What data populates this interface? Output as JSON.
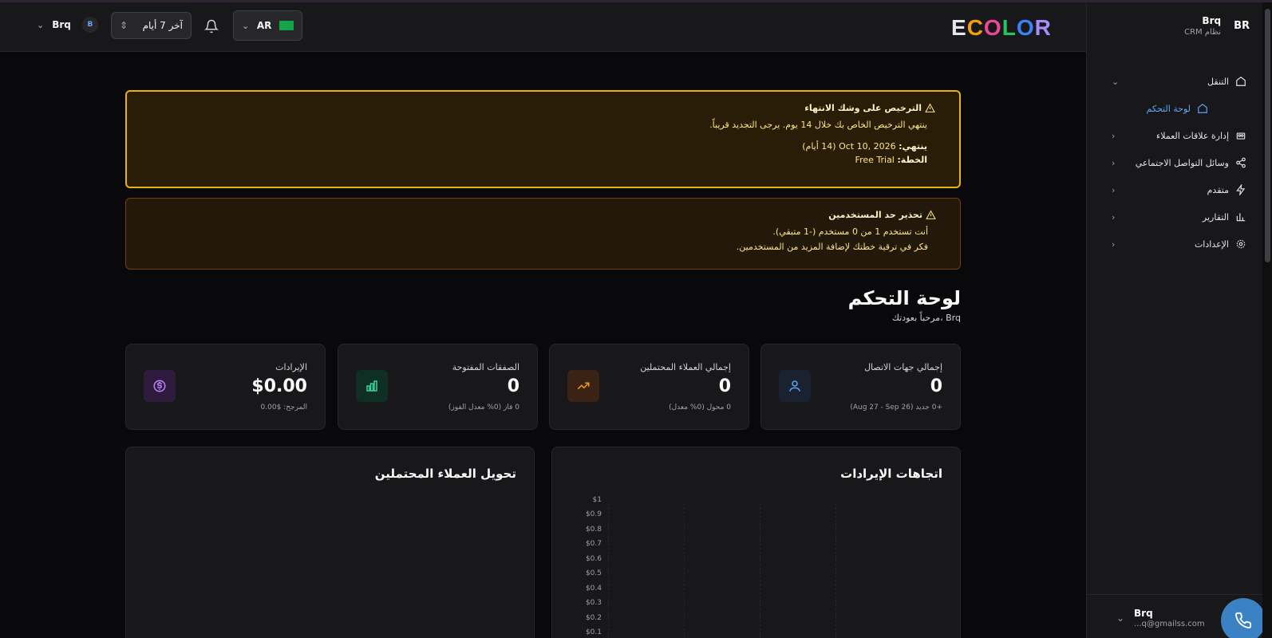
{
  "header": {
    "logo": "ECOLOR",
    "user_name": "Brq",
    "user_badge": "B",
    "period_label": "آخر 7 أيام",
    "language": "AR"
  },
  "sidebar": {
    "avatar": "BR",
    "brand_name": "Brq",
    "brand_sub": "نظام CRM",
    "items": [
      {
        "label": "التنقل",
        "icon": "home-icon"
      },
      {
        "label": "لوحة التحكم",
        "icon": "home-icon"
      },
      {
        "label": "إدارة علاقات العملاء",
        "icon": "users-icon"
      },
      {
        "label": "وسائل التواصل الاجتماعي",
        "icon": "share-icon"
      },
      {
        "label": "متقدم",
        "icon": "bolt-icon"
      },
      {
        "label": "التقارير",
        "icon": "chart-icon"
      },
      {
        "label": "الإعدادات",
        "icon": "gear-icon"
      }
    ],
    "footer_user": "Brq",
    "footer_email": "...q@gmailss.com"
  },
  "alerts": {
    "license": {
      "title": "الترخيص على وشك الانتهاء",
      "message": "ينتهي الترخيص الخاص بك خلال 14 يوم. يرجى التجديد قريباً.",
      "expires_label": "ينتهي:",
      "expires_value": "Oct 10, 2026 (14 أيام)",
      "plan_label": "الخطة:",
      "plan_value": "Free Trial"
    },
    "users": {
      "title": "تحذير حد المستخدمين",
      "line1": "أنت تستخدم 1 من 0 مستخدم (-1 متبقي).",
      "line2": "فكر في ترقية خطتك لإضافة المزيد من المستخدمين."
    }
  },
  "page": {
    "title": "لوحة التحكم",
    "subtitle": "مرحباً بعودتك، Brq"
  },
  "stats": [
    {
      "label": "إجمالي جهات الاتصال",
      "value": "0",
      "note": "+0 جديد (Aug 27 - Sep 26)",
      "icon": "user-icon",
      "color": "#1e293b",
      "accent": "#60a5fa"
    },
    {
      "label": "إجمالي العملاء المحتملين",
      "value": "0",
      "note": "0 محول (0% معدل)",
      "icon": "trending-up-icon",
      "color": "#3a2214",
      "accent": "#f59e0b"
    },
    {
      "label": "الصفقات المفتوحة",
      "value": "0",
      "note": "0 فاز (0% معدل الفوز)",
      "icon": "bar-chart-icon",
      "color": "#0f2e24",
      "accent": "#34d399"
    },
    {
      "label": "الإيرادات",
      "value": "$0.00",
      "note": "المرجح: $0.00",
      "icon": "dollar-icon",
      "color": "#2e1a3d",
      "accent": "#c084fc"
    }
  ],
  "panels": {
    "revenue_title": "اتجاهات الإيرادات",
    "leads_title": "تحويل العملاء المحتملين",
    "y_ticks": [
      "$1",
      "$0.9",
      "$0.8",
      "$0.7",
      "$0.6",
      "$0.5",
      "$0.4",
      "$0.3",
      "$0.2",
      "$0.1"
    ]
  }
}
